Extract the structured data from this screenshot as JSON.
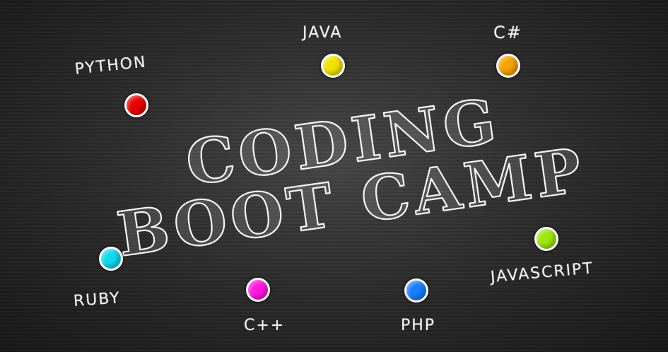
{
  "title": {
    "line1": "CODING",
    "line2": "BOOT CAMP"
  },
  "languages": [
    {
      "id": "python",
      "label": "PYTHON",
      "color": "#e80000"
    },
    {
      "id": "java",
      "label": "JAVA",
      "color": "#f2e200"
    },
    {
      "id": "csharp",
      "label": "C#",
      "color": "#f5a300"
    },
    {
      "id": "ruby",
      "label": "RUBY",
      "color": "#10d8ee"
    },
    {
      "id": "cpp",
      "label": "C++",
      "color": "#ff16e0"
    },
    {
      "id": "php",
      "label": "PHP",
      "color": "#1a7cff"
    },
    {
      "id": "javascript",
      "label": "JAVASCRIPT",
      "color": "#9ee60e"
    }
  ]
}
